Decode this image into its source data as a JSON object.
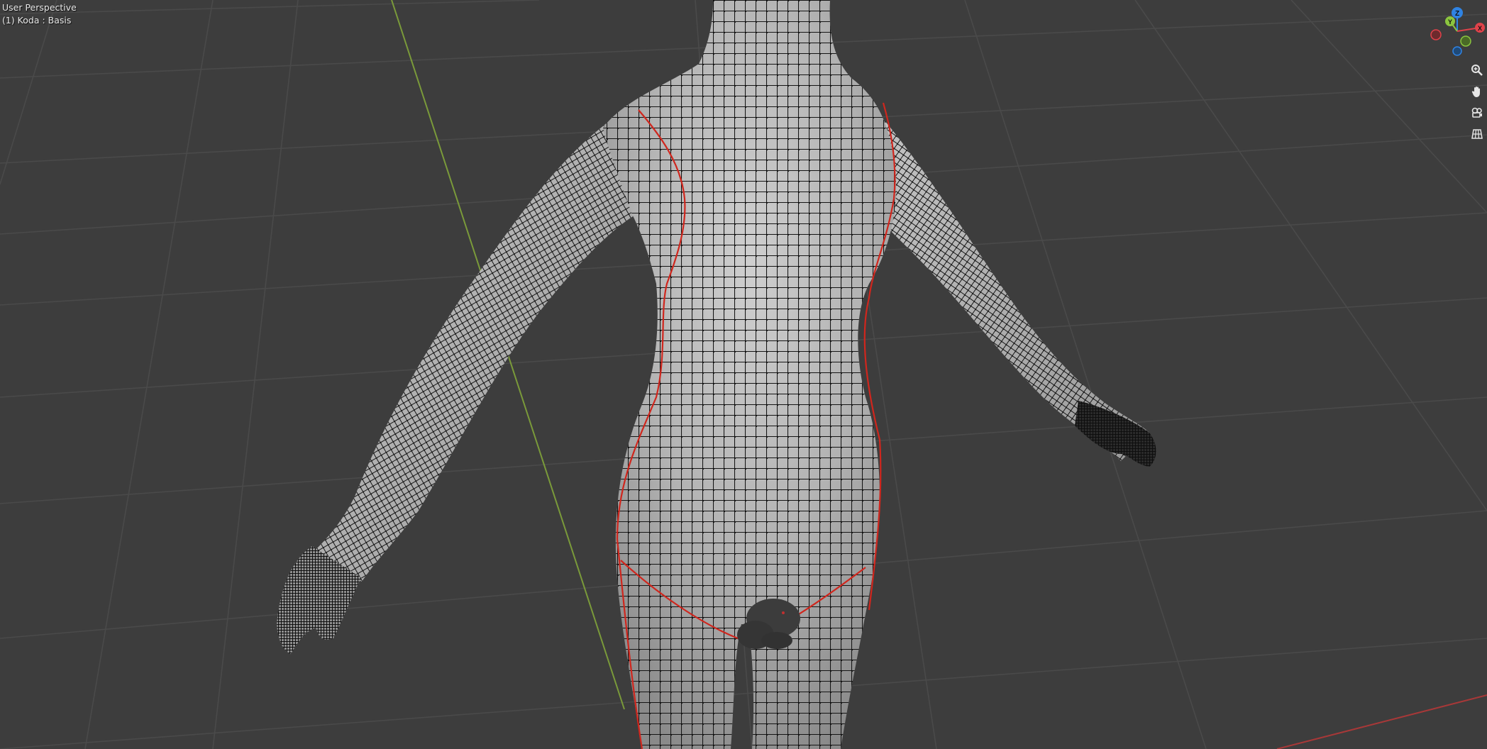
{
  "viewport": {
    "view_name": "User Perspective",
    "object_info": "(1) Koda : Basis"
  },
  "navigation_gizmo": {
    "axes": [
      {
        "name": "Z",
        "color": "#2f83e3"
      },
      {
        "name": "Y",
        "color": "#8bc53f"
      },
      {
        "name": "X",
        "color": "#e0424a"
      }
    ]
  },
  "nav_buttons": [
    {
      "name": "zoom",
      "icon": "magnifier-icon"
    },
    {
      "name": "pan",
      "icon": "hand-icon"
    },
    {
      "name": "camera",
      "icon": "camera-icon"
    },
    {
      "name": "ortho",
      "icon": "grid-icon"
    }
  ],
  "colors": {
    "background": "#3d3d3d",
    "grid_line": "#4a4a4a",
    "y_axis_line": "#7a9a3a",
    "x_axis_line": "#a83838",
    "mesh_surface": "#a9a9a9",
    "mesh_wire": "#141414",
    "seam": "#d0261d"
  }
}
